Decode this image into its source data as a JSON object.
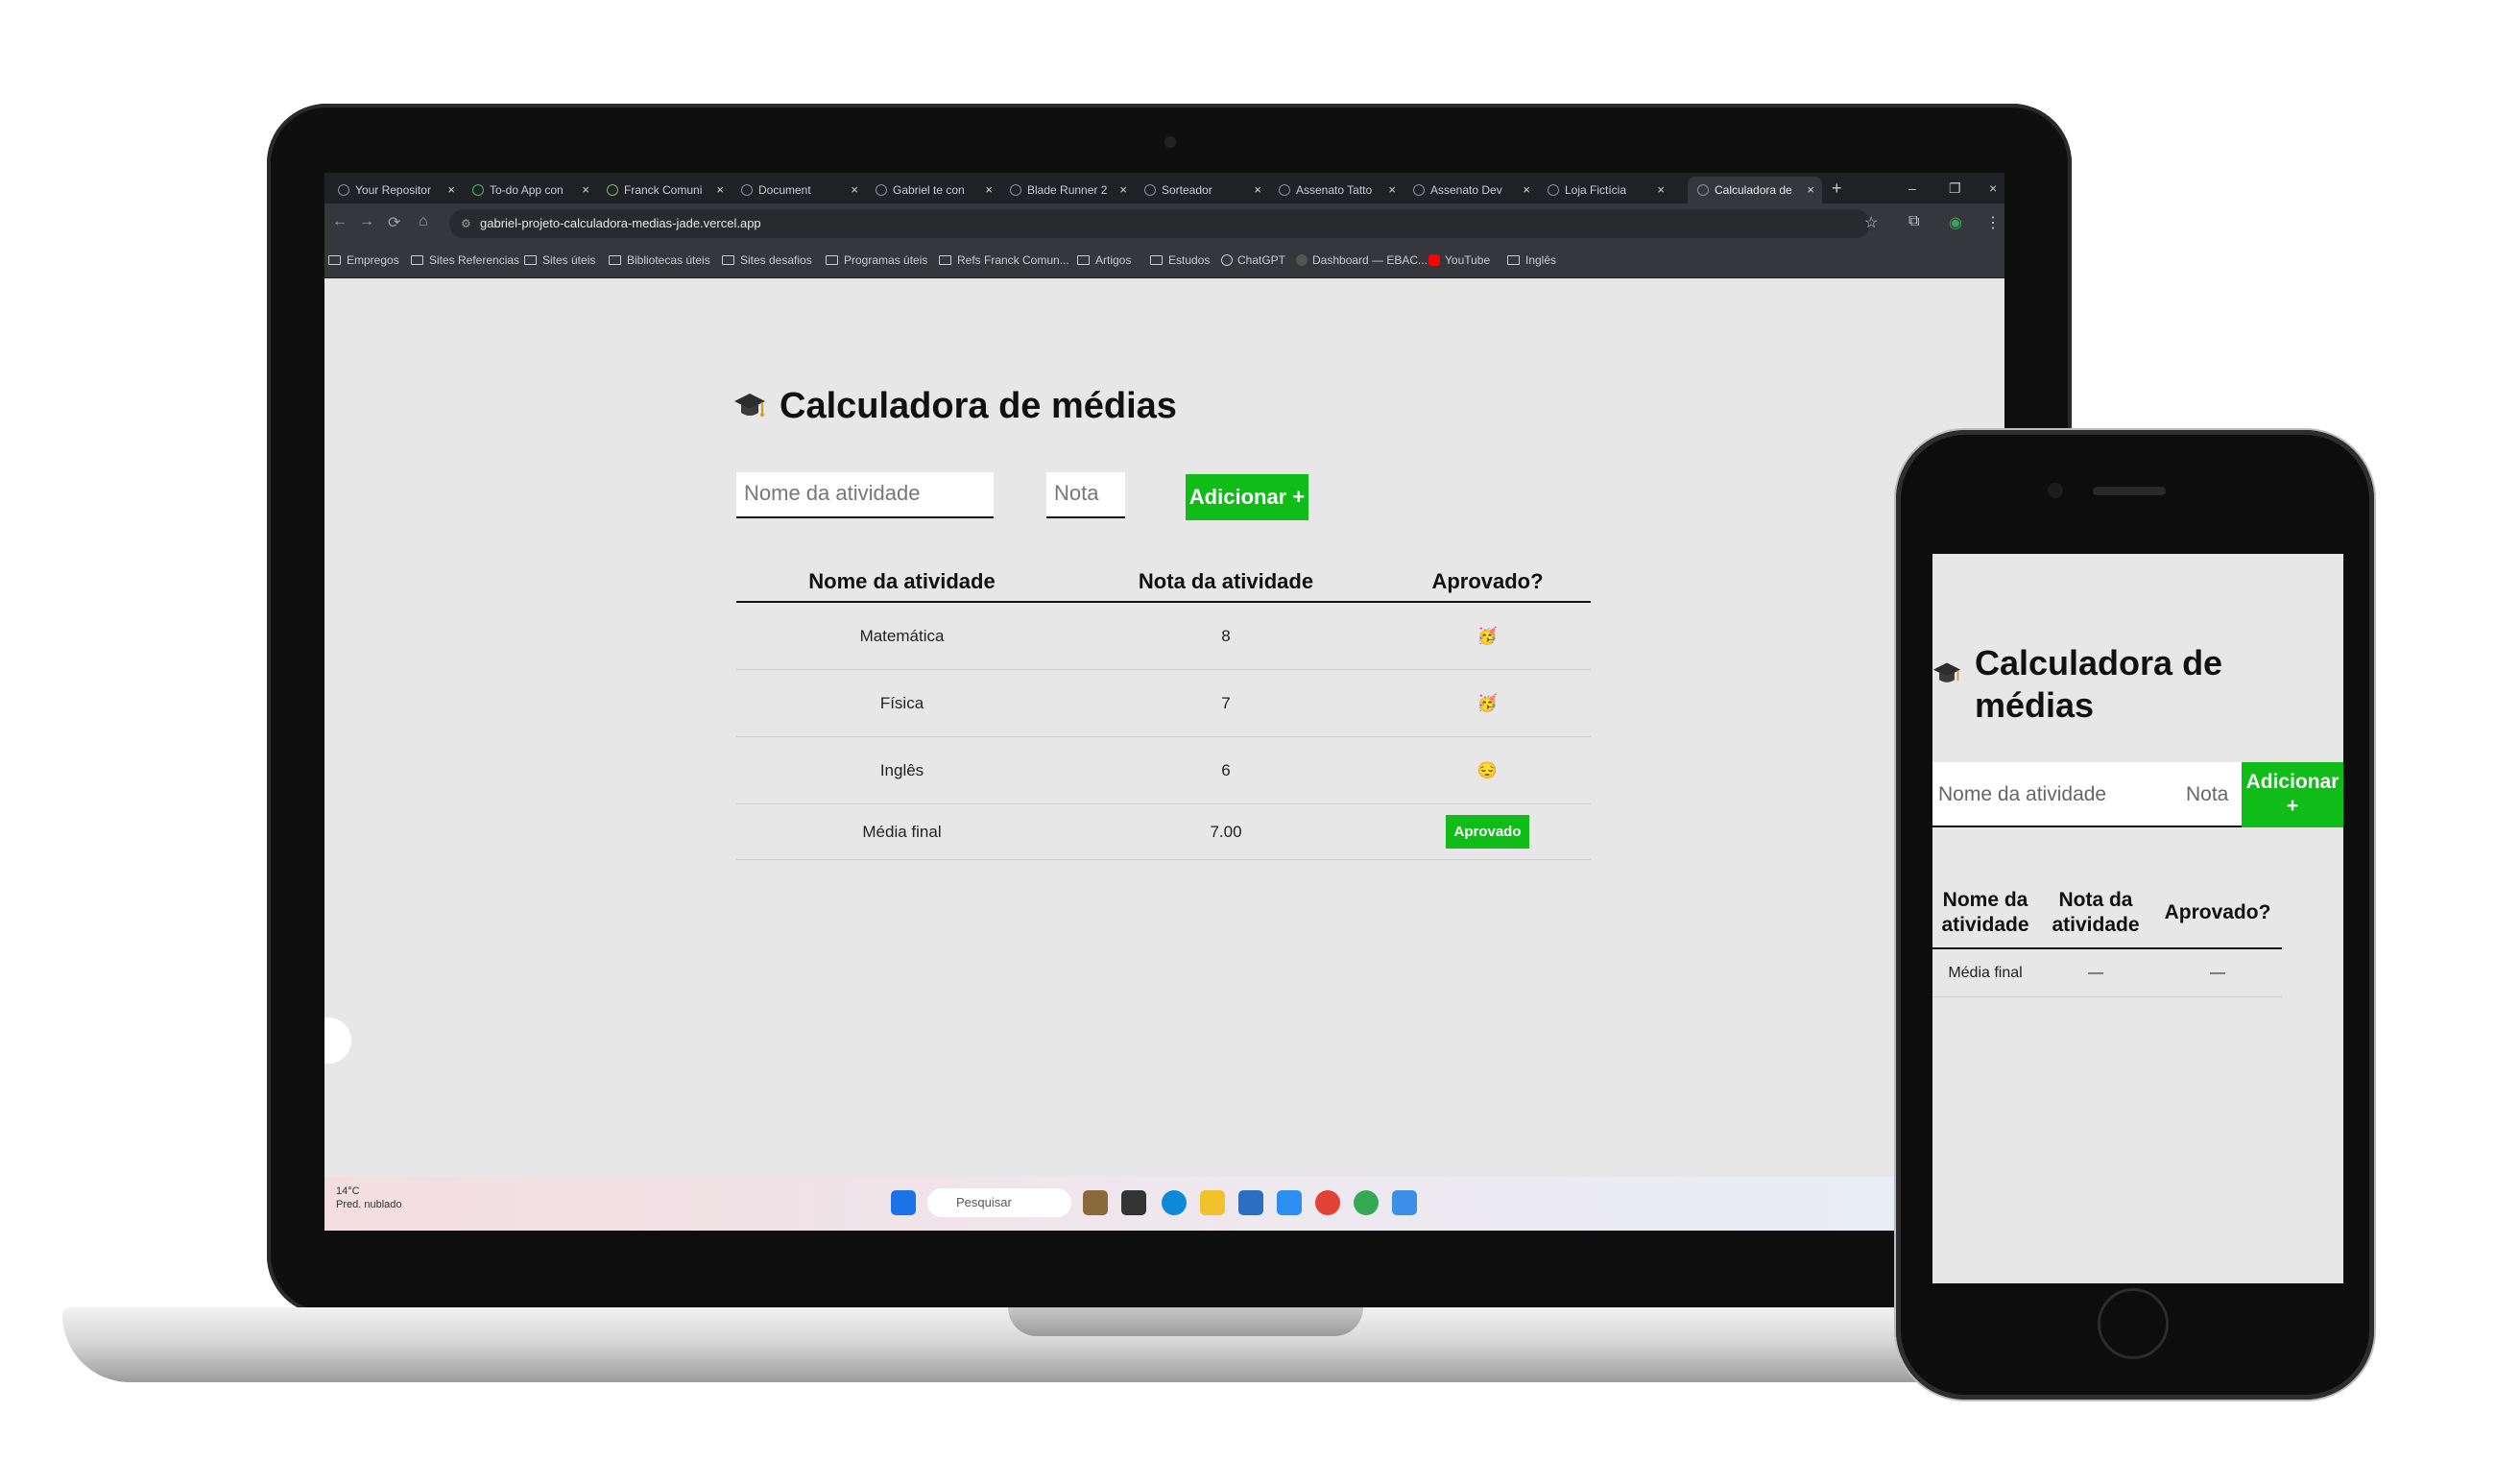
{
  "browser": {
    "tabs": [
      {
        "label": "Your Repositor",
        "close": "×"
      },
      {
        "label": "To-do App con",
        "close": "×"
      },
      {
        "label": "Franck Comuni",
        "close": "×"
      },
      {
        "label": "Document",
        "close": "×"
      },
      {
        "label": "Gabriel te con",
        "close": "×"
      },
      {
        "label": "Blade Runner 2",
        "close": "×"
      },
      {
        "label": "Sorteador",
        "close": "×"
      },
      {
        "label": "Assenato Tatto",
        "close": "×"
      },
      {
        "label": "Assenato Dev",
        "close": "×"
      },
      {
        "label": "Loja Fictícia",
        "close": "×"
      },
      {
        "label": "Calculadora de",
        "close": "×"
      }
    ],
    "new_tab": "+",
    "window_controls": {
      "minimize": "–",
      "restore": "❐",
      "close": "×"
    },
    "url": "gabriel-projeto-calculadora-medias-jade.vercel.app",
    "bookmarks": [
      "Empregos",
      "Sites Referencias",
      "Sites úteis",
      "Bibliotecas úteis",
      "Sites desafios",
      "Programas úteis",
      "Refs Franck Comun...",
      "Artigos",
      "Estudos",
      "ChatGPT",
      "Dashboard — EBAC...",
      "YouTube",
      "Inglês"
    ]
  },
  "app": {
    "title": "Calculadora de médias",
    "name_placeholder": "Nome da atividade",
    "grade_placeholder": "Nota",
    "add_label": "Adicionar +",
    "headers": [
      "Nome da atividade",
      "Nota da atividade",
      "Aprovado?"
    ],
    "rows": [
      {
        "name": "Matemática",
        "grade": "8",
        "emoji": "🥳"
      },
      {
        "name": "Física",
        "grade": "7",
        "emoji": "🥳"
      },
      {
        "name": "Inglês",
        "grade": "6",
        "emoji": "😔"
      }
    ],
    "final_label": "Média final",
    "final_value": "7.00",
    "final_status": "Aprovado"
  },
  "taskbar": {
    "temperature": "14°C",
    "weather": "Pred. nublado",
    "search_placeholder": "Pesquisar"
  },
  "phone": {
    "title": "Calculadora de médias",
    "name_placeholder": "Nome da atividade",
    "grade_placeholder": "Nota",
    "add_label": "Adicionar +",
    "headers": [
      "Nome da atividade",
      "Nota da atividade",
      "Aprovado?"
    ],
    "final_label": "Média final",
    "final_value": "—",
    "final_status": "—"
  },
  "colors": {
    "accent": "#10bd18",
    "page_bg": "#e7e7e7",
    "chrome_dark": "#35373c"
  }
}
